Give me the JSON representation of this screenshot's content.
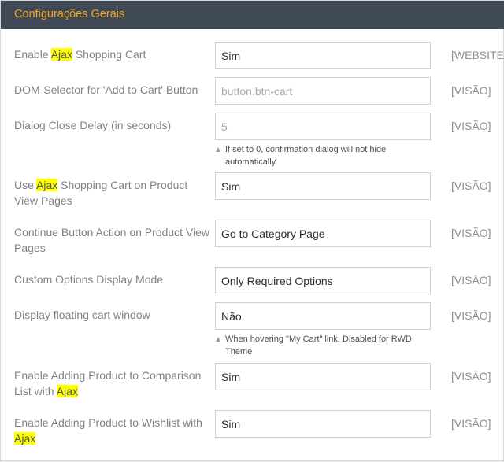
{
  "section": {
    "title": "Configurações Gerais"
  },
  "rows": [
    {
      "pre": "Enable ",
      "hl": "Ajax",
      "post": " Shopping Cart",
      "value": "Sim",
      "scope": "[WEBSITE]"
    },
    {
      "pre": "DOM-Selector for 'Add to Cart' Button",
      "hl": "",
      "post": "",
      "value": "button.btn-cart",
      "scope": "[VISÃO]"
    },
    {
      "pre": "Dialog Close Delay (in seconds)",
      "hl": "",
      "post": "",
      "value": "5",
      "scope": "[VISÃO]",
      "note": "If set to 0, confirmation dialog will not hide automatically."
    },
    {
      "pre": "Use ",
      "hl": "Ajax",
      "post": " Shopping Cart on Product View Pages",
      "value": "Sim",
      "scope": "[VISÃO]"
    },
    {
      "pre": "Continue Button Action on Product View Pages",
      "hl": "",
      "post": "",
      "value": "Go to Category Page",
      "scope": "[VISÃO]"
    },
    {
      "pre": "Custom Options Display Mode",
      "hl": "",
      "post": "",
      "value": "Only Required Options",
      "scope": "[VISÃO]"
    },
    {
      "pre": "Display floating cart window",
      "hl": "",
      "post": "",
      "value": "Não",
      "scope": "[VISÃO]",
      "note": "When hovering \"My Cart\" link. Disabled for RWD Theme"
    },
    {
      "pre": "Enable Adding Product to Comparison List with ",
      "hl": "Ajax",
      "post": "",
      "value": "Sim",
      "scope": "[VISÃO]"
    },
    {
      "pre": "Enable Adding Product to Wishlist with ",
      "hl": "Ajax",
      "post": "",
      "value": "Sim",
      "scope": "[VISÃO]"
    }
  ]
}
